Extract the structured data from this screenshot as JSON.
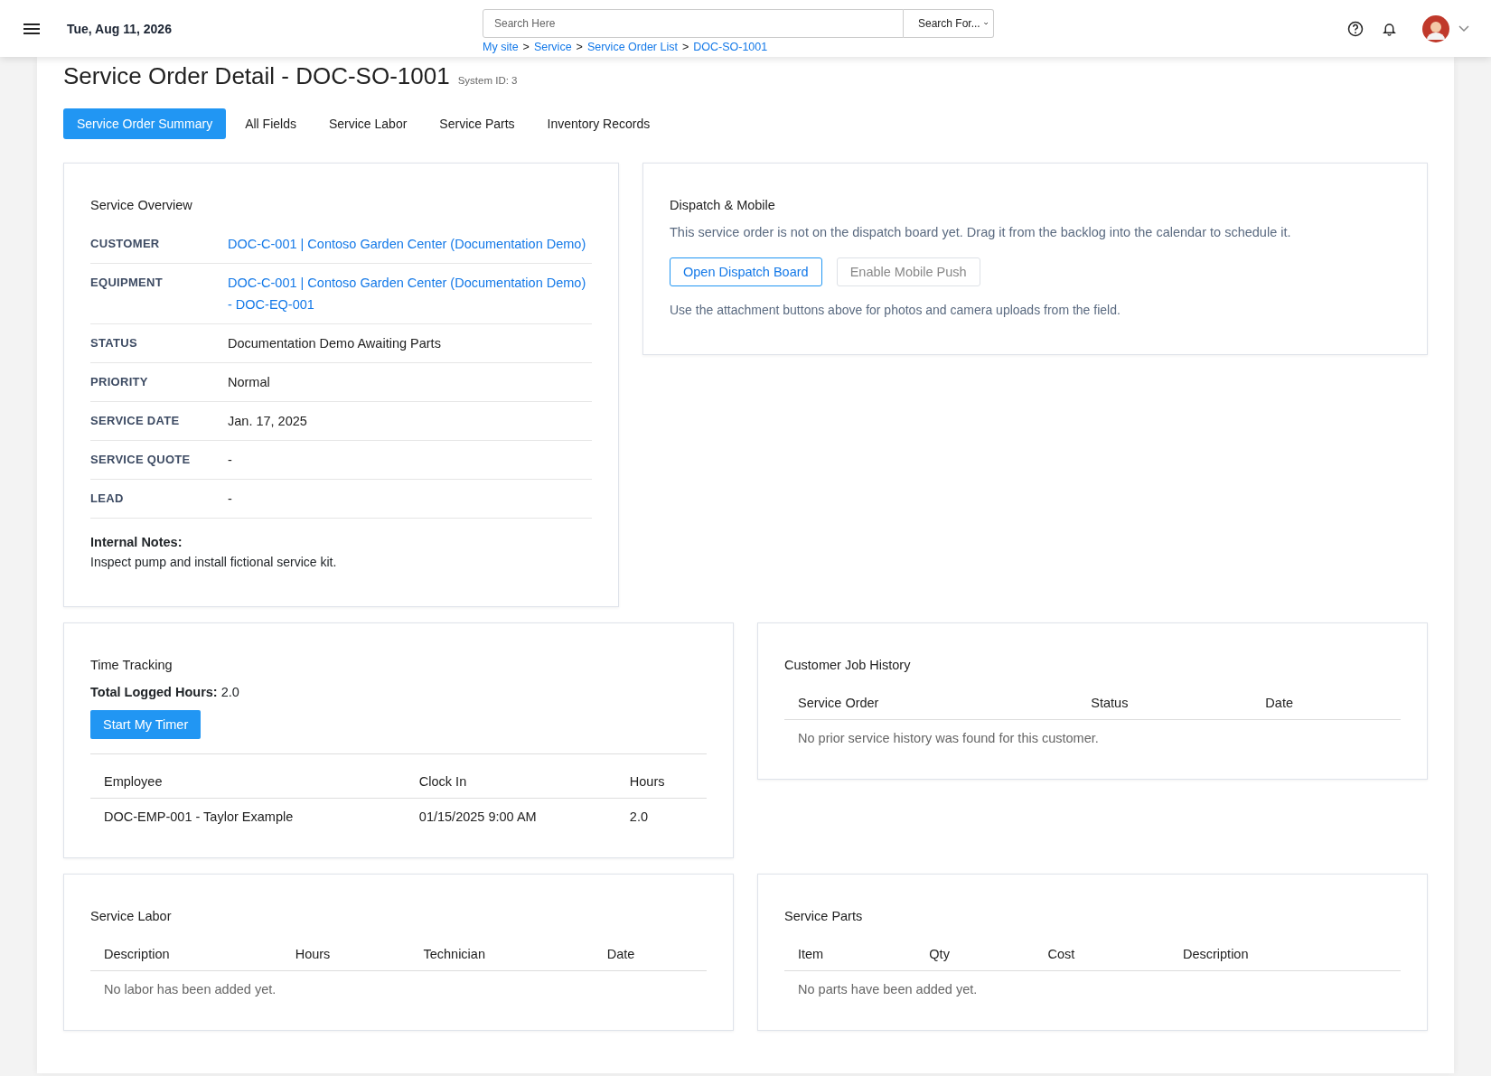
{
  "header": {
    "date": "Tue, Aug 11, 2026",
    "search": {
      "placeholder": "Search Here"
    },
    "search_scope": "Search For...",
    "breadcrumbs": [
      "My site",
      "Service",
      "Service Order List",
      "DOC-SO-1001"
    ],
    "breadcrumb_separator": ">"
  },
  "page": {
    "title": "Service Order Detail - DOC-SO-1001",
    "system_id": "System ID: 3"
  },
  "tabs": [
    {
      "label": "Service Order Summary",
      "selected": true
    },
    {
      "label": "All Fields",
      "selected": false
    },
    {
      "label": "Service Labor",
      "selected": false
    },
    {
      "label": "Service Parts",
      "selected": false
    },
    {
      "label": "Inventory Records",
      "selected": false
    }
  ],
  "overview": {
    "title": "Service Overview",
    "fields": [
      {
        "label": "CUSTOMER",
        "value": "DOC-C-001 | Contoso Garden Center (Documentation Demo)",
        "kind": "link"
      },
      {
        "label": "EQUIPMENT",
        "value": "DOC-C-001 | Contoso Garden Center (Documentation Demo) - DOC-EQ-001",
        "kind": "link"
      },
      {
        "label": "STATUS",
        "value": "Documentation Demo Awaiting Parts",
        "kind": "text"
      },
      {
        "label": "PRIORITY",
        "value": "Normal",
        "kind": "text"
      },
      {
        "label": "SERVICE DATE",
        "value": "Jan. 17, 2025",
        "kind": "text"
      },
      {
        "label": "SERVICE QUOTE",
        "value": "-",
        "kind": "text"
      },
      {
        "label": "LEAD",
        "value": "-",
        "kind": "text"
      }
    ],
    "notes_label": "Internal Notes:",
    "notes": "Inspect pump and install fictional service kit."
  },
  "dispatch": {
    "title": "Dispatch & Mobile",
    "message": "This service order is not on the dispatch board yet. Drag it from the backlog into the calendar to schedule it.",
    "buttons": [
      {
        "label": "Open Dispatch Board",
        "disabled": false
      },
      {
        "label": "Enable Mobile Push",
        "disabled": true
      }
    ],
    "hint": "Use the attachment buttons above for photos and camera uploads from the field."
  },
  "time_tracking": {
    "title": "Time Tracking",
    "total_label": "Total Logged Hours:",
    "total": "2.0",
    "button": "Start My Timer",
    "columns": [
      "Employee",
      "Clock In",
      "Hours"
    ],
    "rows": [
      [
        "DOC-EMP-001 - Taylor Example",
        "01/15/2025 9:00 AM",
        "2.0"
      ]
    ]
  },
  "job_history": {
    "title": "Customer Job History",
    "columns": [
      "Service Order",
      "Status",
      "Date"
    ],
    "empty": "No prior service history was found for this customer."
  },
  "service_labor": {
    "title": "Service Labor",
    "columns": [
      "Description",
      "Hours",
      "Technician",
      "Date"
    ],
    "empty": "No labor has been added yet."
  },
  "service_parts": {
    "title": "Service Parts",
    "columns": [
      "Item",
      "Qty",
      "Cost",
      "Description"
    ],
    "empty": "No parts have been added yet."
  }
}
